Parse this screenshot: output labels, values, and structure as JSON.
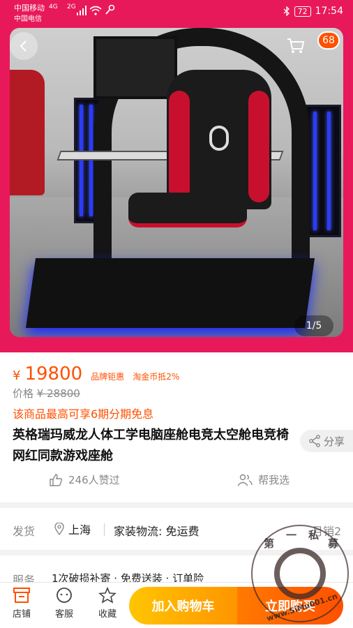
{
  "status_bar": {
    "carrier_1": "中国移动",
    "carrier_2": "中国电信",
    "signal_1": "4G",
    "signal_2": "2G",
    "battery": "72",
    "time": "17:54"
  },
  "header": {
    "cart_badge": "68",
    "image_indicator": "1/5"
  },
  "product": {
    "currency": "¥",
    "price": "19800",
    "tag_brand": "品牌钜惠",
    "tag_coin": "淘金币抵2%",
    "original_label": "价格",
    "original_price": "¥ 28800",
    "installment": "该商品最高可享6期分期免息",
    "title": "英格瑞玛威龙人体工学电脑座舱电竞太空舱电竞椅网红同款游戏座舱",
    "share_label": "分享",
    "likes": "246人赞过",
    "help_pick": "帮我选"
  },
  "shipping": {
    "label": "发货",
    "location": "上海",
    "method": "家装物流: 免运费",
    "sold": "月销2"
  },
  "service": {
    "label": "服务",
    "text": "1次破损补寄 · 免费送装 · 订单险"
  },
  "bottom_bar": {
    "store": "店铺",
    "service": "客服",
    "favorite": "收藏",
    "add_cart": "加入购物车",
    "buy_now": "立即购买"
  },
  "watermark": {
    "chars": [
      "第",
      "一",
      "私",
      "募"
    ],
    "url": "www.SiMu001.cn"
  },
  "colors": {
    "hero_bg": "#e8195a",
    "accent": "#ff5000",
    "cart_btn": "#ffb000"
  }
}
